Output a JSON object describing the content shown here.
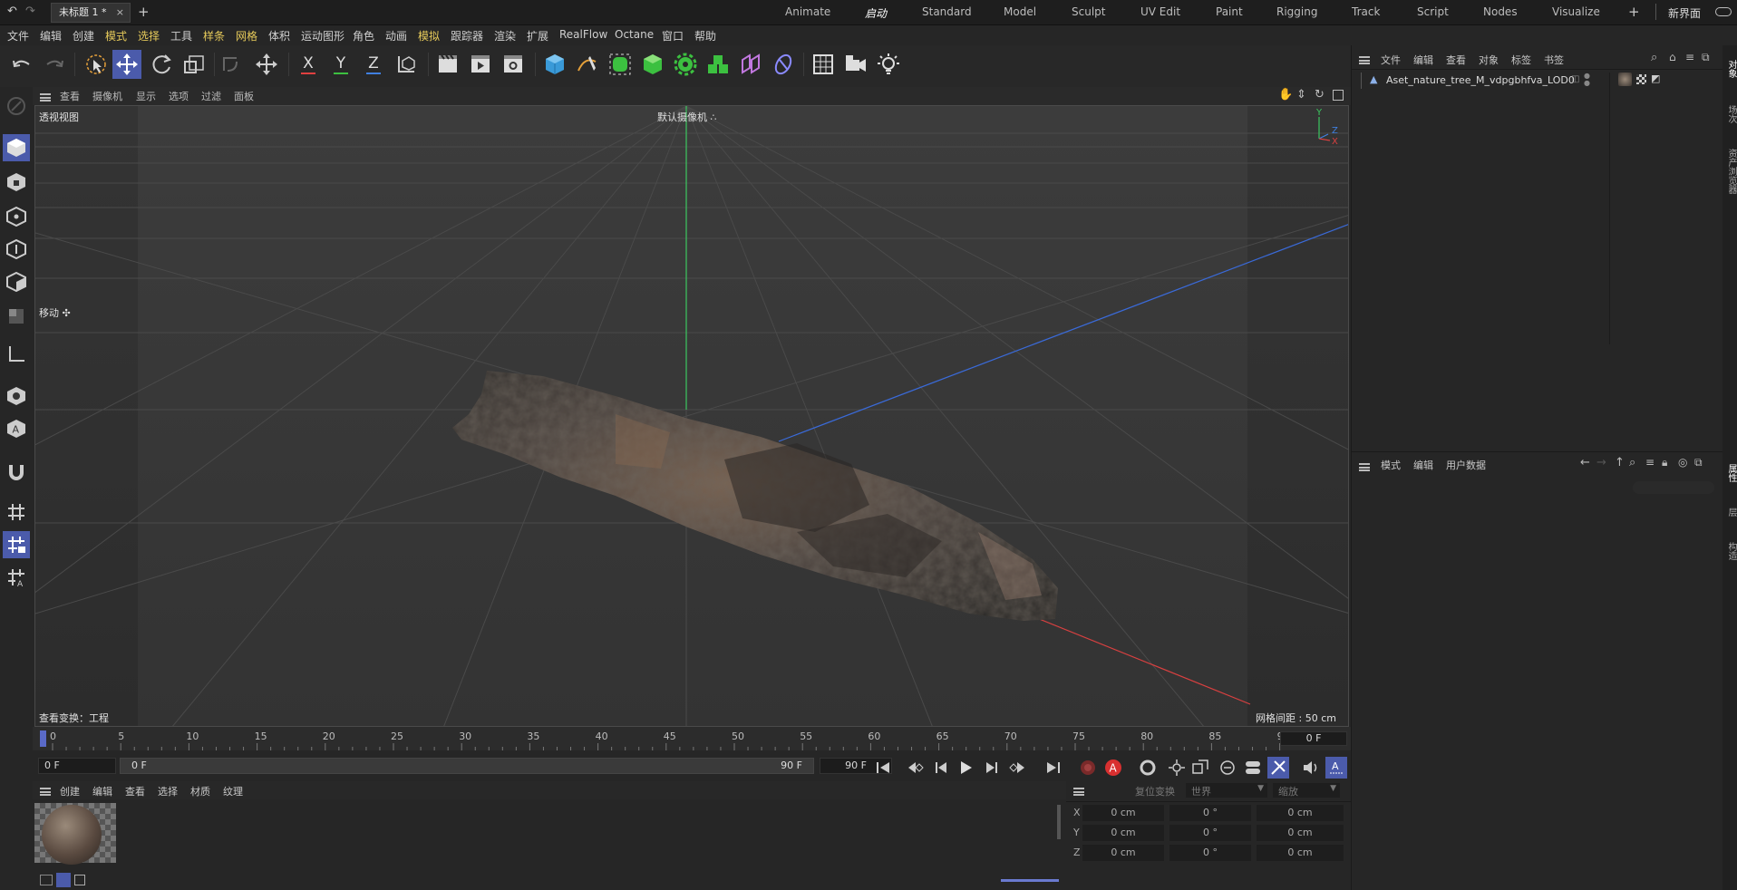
{
  "title_bar": {
    "doc_tab": "未标题 1 *",
    "new_tab": "+",
    "layouts": [
      "Animate",
      "启动",
      "Standard",
      "Model",
      "Sculpt",
      "UV Edit",
      "Paint",
      "Rigging",
      "Track",
      "Script",
      "Nodes",
      "Visualize"
    ],
    "add_layout": "+",
    "new_interface": "新界面"
  },
  "menubar": [
    "文件",
    "编辑",
    "创建",
    "模式",
    "选择",
    "工具",
    "样条",
    "网格",
    "体积",
    "运动图形",
    "角色",
    "动画",
    "模拟",
    "跟踪器",
    "渲染",
    "扩展",
    "RealFlow",
    "Octane",
    "窗口",
    "帮助"
  ],
  "toolbar": {
    "x": "X",
    "y": "Y",
    "z": "Z"
  },
  "viewport": {
    "menus": [
      "查看",
      "摄像机",
      "显示",
      "选项",
      "过滤",
      "面板"
    ],
    "view_name": "透视视图",
    "camera": "默认摄像机 ∴",
    "move_label": "移动 ✣",
    "transform_info": "查看变换：工程",
    "grid_spacing": "网格间距 : 50 cm",
    "axis": {
      "y": "Y",
      "z": "Z",
      "x": "X"
    }
  },
  "timeline": {
    "ticks": [
      "0",
      "5",
      "10",
      "15",
      "20",
      "25",
      "30",
      "35",
      "40",
      "45",
      "50",
      "55",
      "60",
      "65",
      "70",
      "75",
      "80",
      "85",
      "90"
    ],
    "current_frame": "0 F"
  },
  "transport": {
    "start": "0 F",
    "range_start": "0 F",
    "range_end": "90 F",
    "end": "90 F"
  },
  "material_panel": {
    "menus": [
      "创建",
      "编辑",
      "查看",
      "选择",
      "材质",
      "纹理"
    ]
  },
  "coordinates": {
    "header": [
      "复位变换",
      "世界",
      "缩放"
    ],
    "rows": [
      {
        "axis": "X",
        "pos": "0 cm",
        "rot": "0 °",
        "size": "0 cm"
      },
      {
        "axis": "Y",
        "pos": "0 cm",
        "rot": "0 °",
        "size": "0 cm"
      },
      {
        "axis": "Z",
        "pos": "0 cm",
        "rot": "0 °",
        "size": "0 cm"
      }
    ]
  },
  "object_manager": {
    "menus": [
      "文件",
      "编辑",
      "查看",
      "对象",
      "标签",
      "书签"
    ],
    "object_name": "Aset_nature_tree_M_vdpgbhfva_LOD0"
  },
  "attribute_manager": {
    "menus": [
      "模式",
      "编辑",
      "用户数据"
    ]
  },
  "right_strip": [
    "对象",
    "场次",
    "资产浏览器",
    "属性",
    "层",
    "构造"
  ]
}
